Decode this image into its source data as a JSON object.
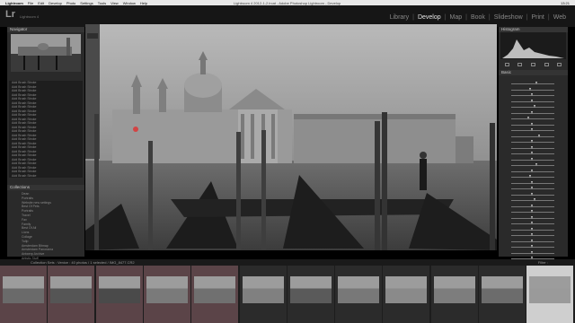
{
  "menubar": {
    "app": "Lightroom",
    "items": [
      "File",
      "Edit",
      "Develop",
      "Photo",
      "Settings",
      "Tools",
      "View",
      "Window",
      "Help"
    ],
    "window_title": "Lightroom 4 2012-1-2.lrcat - Adobe Photoshop Lightroom - Develop",
    "clock": "13:21"
  },
  "topbar": {
    "logo": "Lr",
    "catalog": "Lightroom 4",
    "modules": [
      "Library",
      "Develop",
      "Map",
      "Book",
      "Slideshow",
      "Print",
      "Web"
    ],
    "active_module": "Develop"
  },
  "left": {
    "navigator_title": "Navigator",
    "history": [
      "Add Brush Stroke",
      "Add Brush Stroke",
      "Add Brush Stroke",
      "Add Brush Stroke",
      "Add Brush Stroke",
      "Add Brush Stroke",
      "Add Brush Stroke",
      "Add Brush Stroke",
      "Add Brush Stroke",
      "Add Brush Stroke",
      "Add Brush Stroke",
      "Add Brush Stroke",
      "Add Brush Stroke",
      "Add Brush Stroke",
      "Add Brush Stroke",
      "Add Brush Stroke",
      "Add Brush Stroke",
      "Add Brush Stroke",
      "Add Brush Stroke",
      "Add Brush Stroke",
      "Add Brush Stroke",
      "Add Brush Stroke",
      "Add Brush Stroke",
      "Add Brush Stroke"
    ],
    "collections_title": "Collections",
    "collections": [
      "Dean",
      "Portraits",
      "Website new settings",
      "Best Of Pets",
      "Portraits",
      "Travel",
      "Fav",
      "Family",
      "Best Of All",
      "Lions",
      "Collage",
      "Tulip",
      "Amsterdam Bitmap",
      "Amsterdam Panorama",
      "Antwerp Archive",
      "Artistic Stuff",
      "Boys",
      "Brussels",
      "Brussels 2 Jaar",
      "Brussel Archive",
      "Panoramas",
      "Photoshop",
      "Project Lions",
      "Collage"
    ],
    "btn_copy": "Copy...",
    "btn_paste": "Paste"
  },
  "right": {
    "panel_title": "Histogram",
    "basic_title": "Basic",
    "sliders": [
      0.6,
      0.45,
      0.5,
      0.5,
      0.55,
      0.5,
      0.4,
      0.5,
      0.5,
      0.65,
      0.5,
      0.5,
      0.5,
      0.5,
      0.6,
      0.5,
      0.45,
      0.5,
      0.5,
      0.5,
      0.55,
      0.5,
      0.5,
      0.5,
      0.5,
      0.5,
      0.5,
      0.5,
      0.5,
      0.5,
      0.5,
      0.5,
      0.5
    ],
    "btn_previous": "Previous",
    "btn_reset": "Reset"
  },
  "filmstrip": {
    "crumb": "Collection Sets : Venice : 40 photos / 1 selected / IMG_8477.CR2",
    "filter": "Filter :",
    "selected_index": 11,
    "picked": [
      0,
      1,
      2,
      3,
      4
    ]
  }
}
